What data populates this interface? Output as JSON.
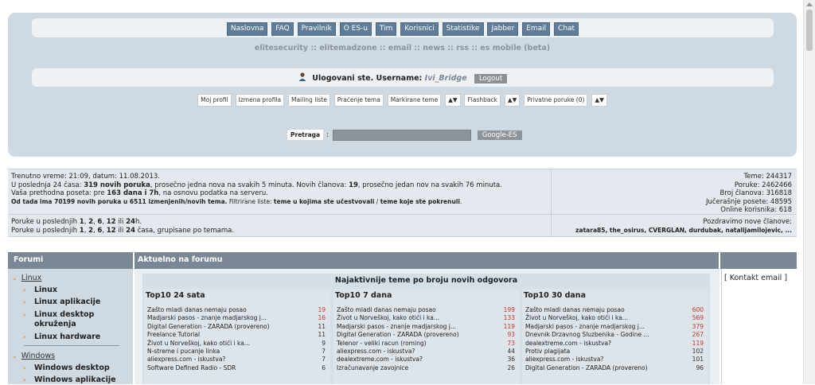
{
  "nav": {
    "items": [
      "Naslovna",
      "FAQ",
      "Pravilnik",
      "O ES-u",
      "Tim",
      "Korisnici",
      "Statistike",
      "Jabber",
      "Email",
      "Chat"
    ]
  },
  "sub_links": "elitesecurity :: elitemadzone :: email :: news :: rss :: es mobile (beta)",
  "user": {
    "label": "Ulogovani ste. Username:",
    "username": "Ivi_Bridge",
    "logout": "Logout"
  },
  "toolbar": {
    "items": [
      "Moj profil",
      "Izmena profila",
      "Mailing liste",
      "Praćenje tema",
      "Markirane teme",
      "▲▼",
      "Flashback",
      "▲▼",
      "Privatne poruke (0)",
      "▲▼"
    ]
  },
  "search": {
    "label": "Pretraga",
    "colon": ":",
    "button": "Google-ES"
  },
  "stats": {
    "line1": "Trenutno vreme: 21:09, datum: 11.08.2013.",
    "line2_a": "U poslednja 24 časa: ",
    "line2_b": "319 novih poruka",
    "line2_c": ", prosečno jedna nova na svakih 5 minuta. Novih članova: ",
    "line2_d": "19",
    "line2_e": ", prosečno jedan nov na svakih 76 minuta.",
    "line3_a": "Vaša prethodna poseta: pre ",
    "line3_b": "163 dana i 7h",
    "line3_c": ", na osnovu podatka na serveru.",
    "line4_a": "Od tada ima 70199 novih poruka u 6511 izmenjenih/novih tema.",
    "line4_b": " Filtrirane liste: ",
    "line4_c": "teme u kojima ste učestvovali",
    "line4_d": " / ",
    "line4_e": "teme koje ste pokrenuli",
    "line4_f": ".",
    "right": [
      "Teme: 244317",
      "Poruke: 2462466",
      "Broj članova: 316818",
      "Jučerašnje posete: 48595",
      "Online korisnika: 618"
    ],
    "posts_a1": "Poruke u poslednjih ",
    "posts_b1": "1",
    "posts_c1": ", ",
    "posts_d1": "2",
    "posts_e1": ", ",
    "posts_f1": "6",
    "posts_g1": ", ",
    "posts_h1": "12",
    "posts_i1": " ili ",
    "posts_j1": "24",
    "posts_k1": "h.",
    "posts_a2": "Poruke u poslednjih ",
    "posts_b2": "1",
    "posts_c2": ", ",
    "posts_d2": "2",
    "posts_e2": ", ",
    "posts_f2": "6",
    "posts_g2": ", ",
    "posts_h2": "12",
    "posts_i2": " ili ",
    "posts_j2": "24",
    "posts_k2": " časa, grupisane po temama.",
    "welcome": "Pozdravimo nove članove:",
    "new_members": "zatara85, the_osirus, CVERGLAN, durdubak, natalijamilojevic, ..."
  },
  "forum": {
    "header_forumi": "Forumi",
    "header_aktuelno": "Aktuelno na forumu",
    "categories": [
      {
        "name": "Linux",
        "subs": [
          "Linux",
          "Linux aplikacije",
          "Linux desktop",
          "okruženja",
          "Linux hardware"
        ]
      },
      {
        "name": "Windows",
        "subs": [
          "Windows desktop",
          "Windows aplikacije"
        ]
      }
    ],
    "contact": "[ Kontakt email ]"
  },
  "top10": {
    "title": "Najaktivnije teme po broju novih odgovora",
    "columns": [
      {
        "head": "Top10 24 sata",
        "rows": [
          {
            "t": "Zašto mladi danas nemaju posao",
            "n": "19"
          },
          {
            "t": "Madjarski pasos - znanje madjarskog j...",
            "n": "16"
          },
          {
            "t": "Digital Generation - ZARADA (provereno)",
            "n": "11"
          },
          {
            "t": "Freelance Tutorial",
            "n": "11"
          },
          {
            "t": "Život u Norveškoj, kako otići i ka...",
            "n": "9"
          },
          {
            "t": "N-streme i pucanje linka",
            "n": "7"
          },
          {
            "t": "aliexpress.com - iskustva?",
            "n": "7"
          },
          {
            "t": "Software Defined Radio - SDR",
            "n": "6"
          }
        ]
      },
      {
        "head": "Top10 7 dana",
        "rows": [
          {
            "t": "Zašto mladi danas nemaju posao",
            "n": "199"
          },
          {
            "t": "Život u Norveškoj, kako otići i ka...",
            "n": "133"
          },
          {
            "t": "Madjarski pasos - znanje madjarskog j...",
            "n": "119"
          },
          {
            "t": "Digital Generation - ZARADA (provereno)",
            "n": "93"
          },
          {
            "t": "Telenor - veliki racun (roming)",
            "n": "73"
          },
          {
            "t": "aliexpress.com - iskustva?",
            "n": "44"
          },
          {
            "t": "dealextreme.com - iskustva?",
            "n": "36"
          },
          {
            "t": "Izračunavanje zavojnice",
            "n": "26"
          }
        ]
      },
      {
        "head": "Top10 30 dana",
        "rows": [
          {
            "t": "Zašto mladi danas nemaju posao",
            "n": "600"
          },
          {
            "t": "Život u Norveškoj, kako otići i ka...",
            "n": "569"
          },
          {
            "t": "Madjarski pasos - znanje madjarskog j...",
            "n": "379"
          },
          {
            "t": "Dnevnik Drzavnog Sluzbenika - Godine ...",
            "n": "267"
          },
          {
            "t": "dealextreme.com - iskustva?",
            "n": "119"
          },
          {
            "t": "Protiv plagijata",
            "n": "102"
          },
          {
            "t": "aliexpress.com - iskustva?",
            "n": "101"
          },
          {
            "t": "Digital Generation - ZARADA (provereno)",
            "n": "96"
          }
        ]
      }
    ]
  }
}
